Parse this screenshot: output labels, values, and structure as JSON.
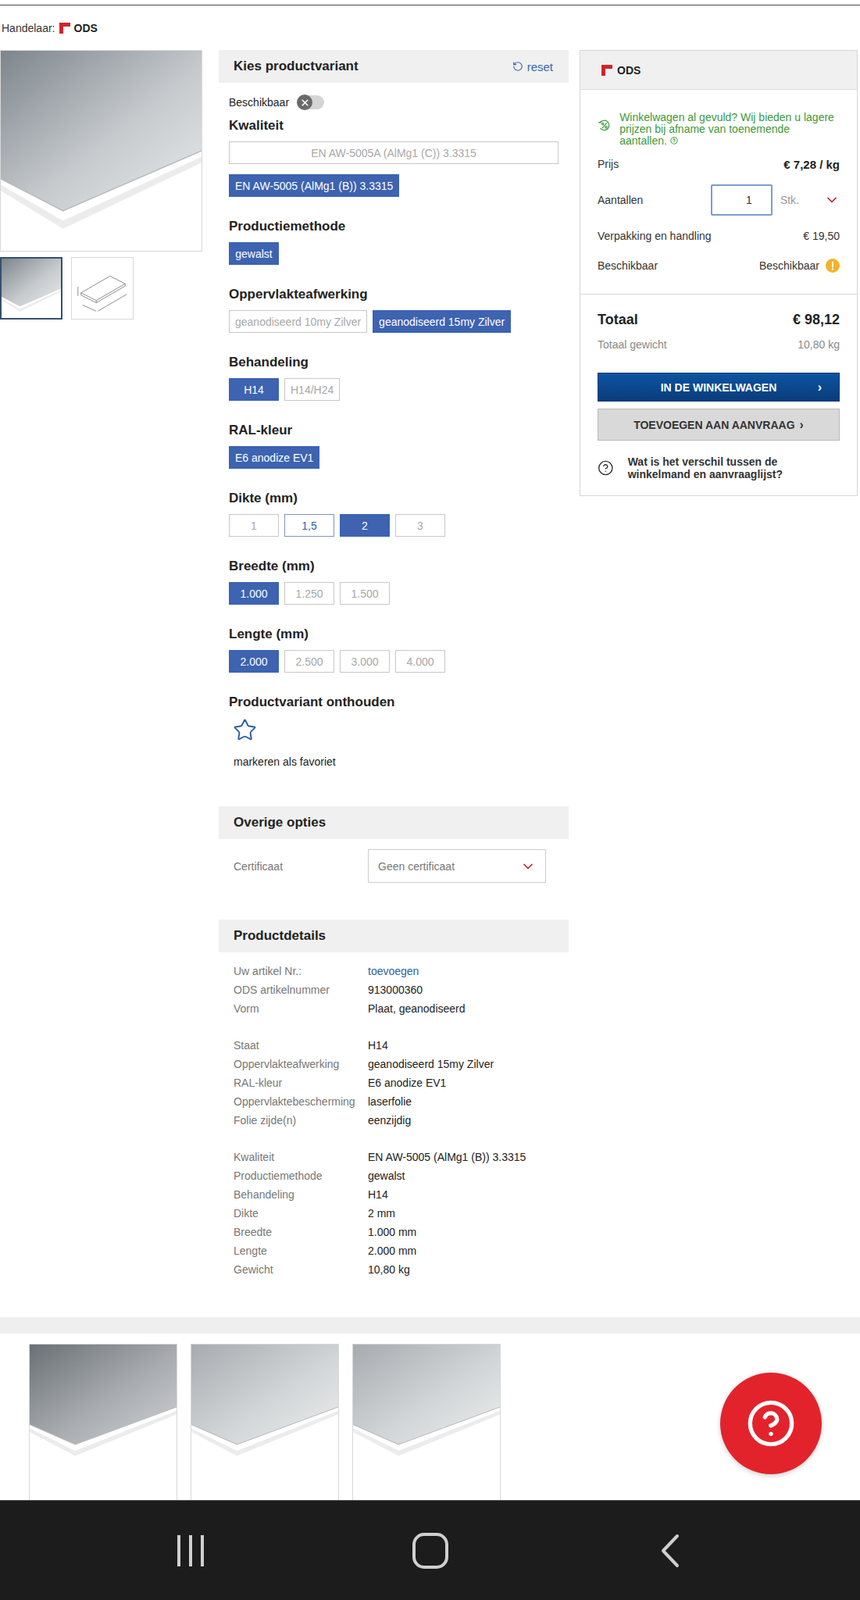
{
  "dealer": {
    "label": "Handelaar:",
    "name": "ODS"
  },
  "gallery": {
    "thumbnails": [
      {
        "kind": "photo",
        "selected": true
      },
      {
        "kind": "drawing",
        "selected": false
      }
    ]
  },
  "variant": {
    "title": "Kies productvariant",
    "reset": "reset",
    "available": {
      "label": "Beschikbaar",
      "on": false
    },
    "groups": [
      {
        "label": "Kwaliteit",
        "kind": "stack",
        "options": [
          {
            "label": "EN AW-5005A (AlMg1 (C)) 3.3315",
            "selected": false,
            "disabled": true
          },
          {
            "label": "EN AW-5005 (AlMg1 (B)) 3.3315",
            "selected": true,
            "disabled": false
          }
        ]
      },
      {
        "label": "Productiemethode",
        "kind": "row",
        "options": [
          {
            "label": "gewalst",
            "selected": true,
            "disabled": false
          }
        ]
      },
      {
        "label": "Oppervlakteafwerking",
        "kind": "row",
        "options": [
          {
            "label": "geanodiseerd 10my Zilver",
            "selected": false,
            "disabled": true
          },
          {
            "label": "geanodiseerd 15my Zilver",
            "selected": true,
            "disabled": false
          }
        ]
      },
      {
        "label": "Behandeling",
        "kind": "row",
        "options": [
          {
            "label": "H14",
            "selected": true,
            "disabled": false
          },
          {
            "label": "H14/H24",
            "selected": false,
            "disabled": true
          }
        ]
      },
      {
        "label": "RAL-kleur",
        "kind": "row",
        "options": [
          {
            "label": "E6 anodize EV1",
            "selected": true,
            "disabled": false
          }
        ]
      },
      {
        "label": "Dikte (mm)",
        "kind": "row",
        "options": [
          {
            "label": "1",
            "selected": false,
            "disabled": true
          },
          {
            "label": "1,5",
            "selected": false,
            "disabled": false
          },
          {
            "label": "2",
            "selected": true,
            "disabled": false
          },
          {
            "label": "3",
            "selected": false,
            "disabled": true
          }
        ]
      },
      {
        "label": "Breedte (mm)",
        "kind": "row",
        "options": [
          {
            "label": "1.000",
            "selected": true,
            "disabled": false
          },
          {
            "label": "1.250",
            "selected": false,
            "disabled": true
          },
          {
            "label": "1.500",
            "selected": false,
            "disabled": true
          }
        ]
      },
      {
        "label": "Lengte (mm)",
        "kind": "row",
        "options": [
          {
            "label": "2.000",
            "selected": true,
            "disabled": false
          },
          {
            "label": "2.500",
            "selected": false,
            "disabled": true
          },
          {
            "label": "3.000",
            "selected": false,
            "disabled": true
          },
          {
            "label": "4.000",
            "selected": false,
            "disabled": true
          }
        ]
      }
    ],
    "favorite": {
      "label": "Productvariant onthouden",
      "caption": "markeren als favoriet",
      "on": false
    }
  },
  "other_options": {
    "title": "Overige opties",
    "rows": [
      {
        "label": "Certificaat",
        "value": "Geen certificaat"
      }
    ]
  },
  "details": {
    "title": "Productdetails",
    "groups": [
      {
        "rows": [
          {
            "label": "Uw artikel Nr.:",
            "value": "toevoegen",
            "kind": "link"
          },
          {
            "label": "ODS artikelnummer",
            "value": "913000360",
            "kind": "text"
          },
          {
            "label": "Vorm",
            "value": "Plaat, geanodiseerd",
            "kind": "text"
          }
        ]
      },
      {
        "rows": [
          {
            "label": "Staat",
            "value": "H14",
            "kind": "text"
          },
          {
            "label": "Oppervlakteafwerking",
            "value": "geanodiseerd 15my Zilver",
            "kind": "text"
          },
          {
            "label": "RAL-kleur",
            "value": "E6 anodize EV1",
            "kind": "text"
          },
          {
            "label": "Oppervlaktebescherming",
            "value": "laserfolie",
            "kind": "text"
          },
          {
            "label": "Folie zijde(n)",
            "value": "eenzijdig",
            "kind": "text"
          }
        ]
      },
      {
        "rows": [
          {
            "label": "Kwaliteit",
            "value": "EN AW-5005 (AlMg1 (B)) 3.3315",
            "kind": "text"
          },
          {
            "label": "Productiemethode",
            "value": "gewalst",
            "kind": "text"
          },
          {
            "label": "Behandeling",
            "value": "H14",
            "kind": "text"
          },
          {
            "label": "Dikte",
            "value": "2 mm",
            "kind": "text"
          },
          {
            "label": "Breedte",
            "value": "1.000 mm",
            "kind": "text"
          },
          {
            "label": "Lengte",
            "value": "2.000 mm",
            "kind": "text"
          },
          {
            "label": "Gewicht",
            "value": "10,80 kg",
            "kind": "text"
          }
        ]
      }
    ]
  },
  "cart": {
    "dealer": "ODS",
    "promo": "Winkelwagen al gevuld? Wij bieden u lagere prijzen bij afname van toenemende aantallen.",
    "rows": [
      {
        "label": "Prijs",
        "value": "€ 7,28 / kg",
        "kind": "price"
      },
      {
        "label": "Aantallen",
        "value": "1",
        "unit": "Stk.",
        "kind": "quantity"
      },
      {
        "label": "Verpakking en handling",
        "value": "€ 19,50",
        "kind": "plain"
      },
      {
        "label": "Beschikbaar",
        "value": "Beschikbaar",
        "kind": "status"
      }
    ],
    "total": {
      "label": "Totaal",
      "value": "€ 98,12"
    },
    "weight": {
      "label": "Totaal gewicht",
      "value": "10,80 kg"
    },
    "buttons": [
      {
        "label": "IN DE WINKELWAGEN",
        "arrow": "›",
        "kind": "primary"
      },
      {
        "label": "TOEVOEGEN AAN AANVRAAG",
        "arrow": "›",
        "kind": "secondary"
      }
    ],
    "help": "Wat is het verschil tussen de winkelmand en aanvraaglijst?"
  },
  "related_products": [
    {
      "kind": "dark"
    },
    {
      "kind": "light"
    },
    {
      "kind": "light"
    }
  ]
}
